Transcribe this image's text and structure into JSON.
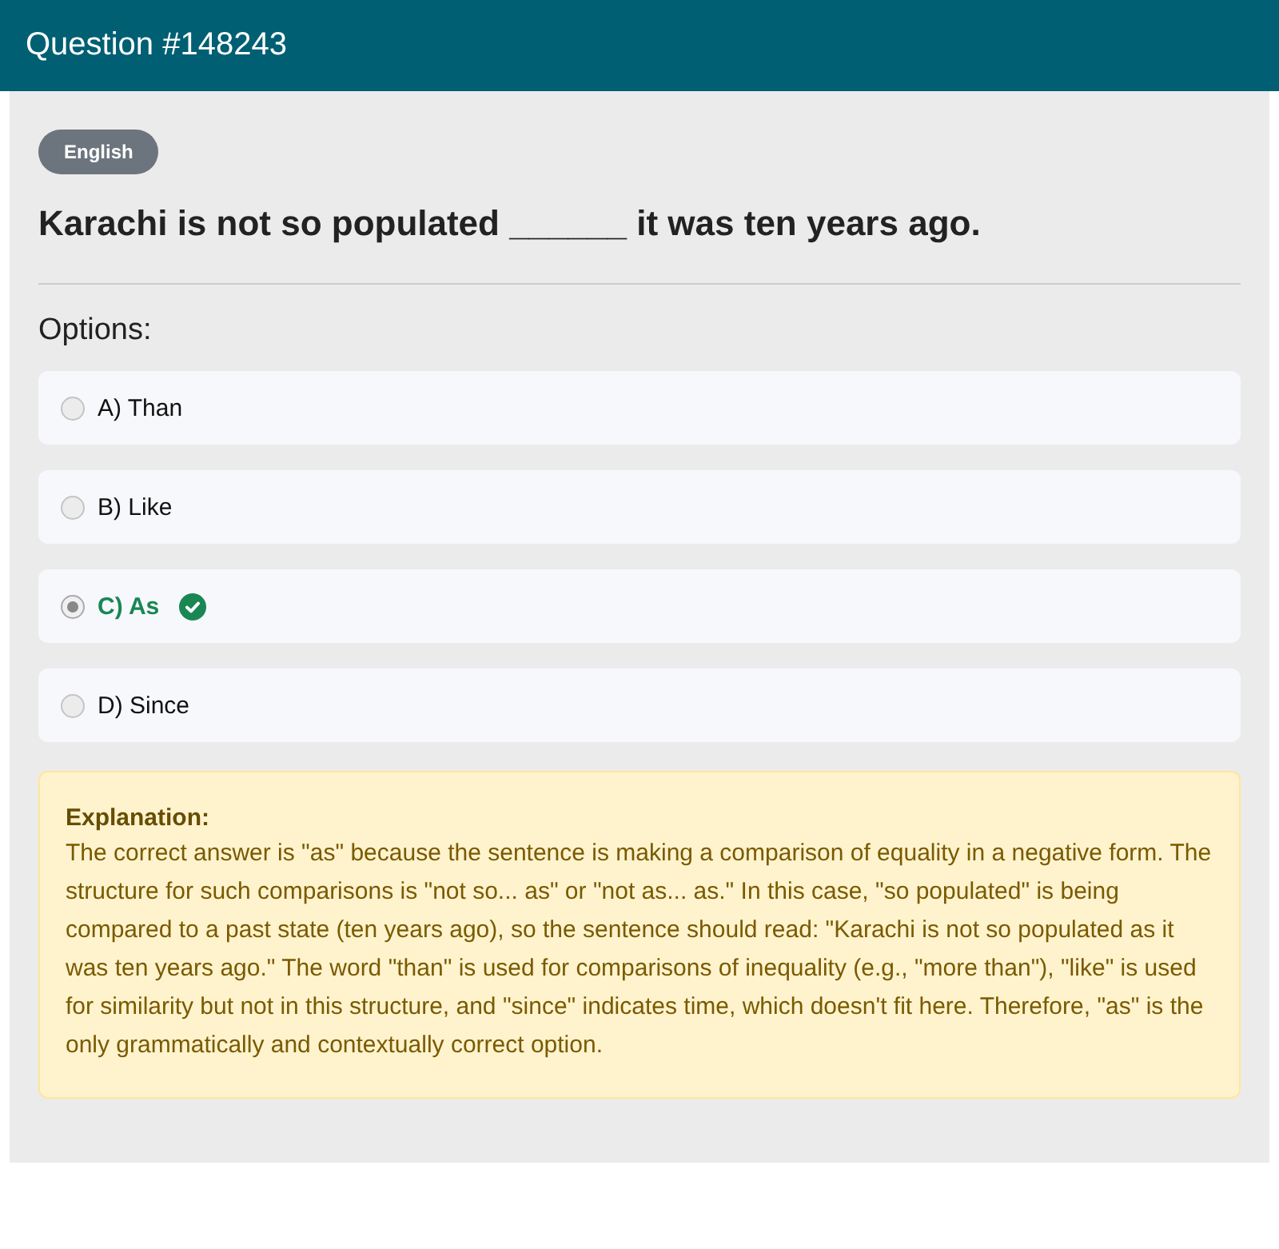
{
  "header": {
    "title": "Question #148243"
  },
  "tag": "English",
  "question": "Karachi is not so populated ______ it was ten years ago.",
  "options_label": "Options:",
  "options": [
    {
      "label": "A) Than",
      "selected": false,
      "correct": false
    },
    {
      "label": "B) Like",
      "selected": false,
      "correct": false
    },
    {
      "label": "C) As",
      "selected": true,
      "correct": true
    },
    {
      "label": "D) Since",
      "selected": false,
      "correct": false
    }
  ],
  "explanation": {
    "title": "Explanation:",
    "text": "The correct answer is \"as\" because the sentence is making a comparison of equality in a negative form. The structure for such comparisons is \"not so... as\" or \"not as... as.\" In this case, \"so populated\" is being compared to a past state (ten years ago), so the sentence should read: \"Karachi is not so populated as it was ten years ago.\" The word \"than\" is used for comparisons of inequality (e.g., \"more than\"), \"like\" is used for similarity but not in this structure, and \"since\" indicates time, which doesn't fit here. Therefore, \"as\" is the only grammatically and contextually correct option."
  }
}
